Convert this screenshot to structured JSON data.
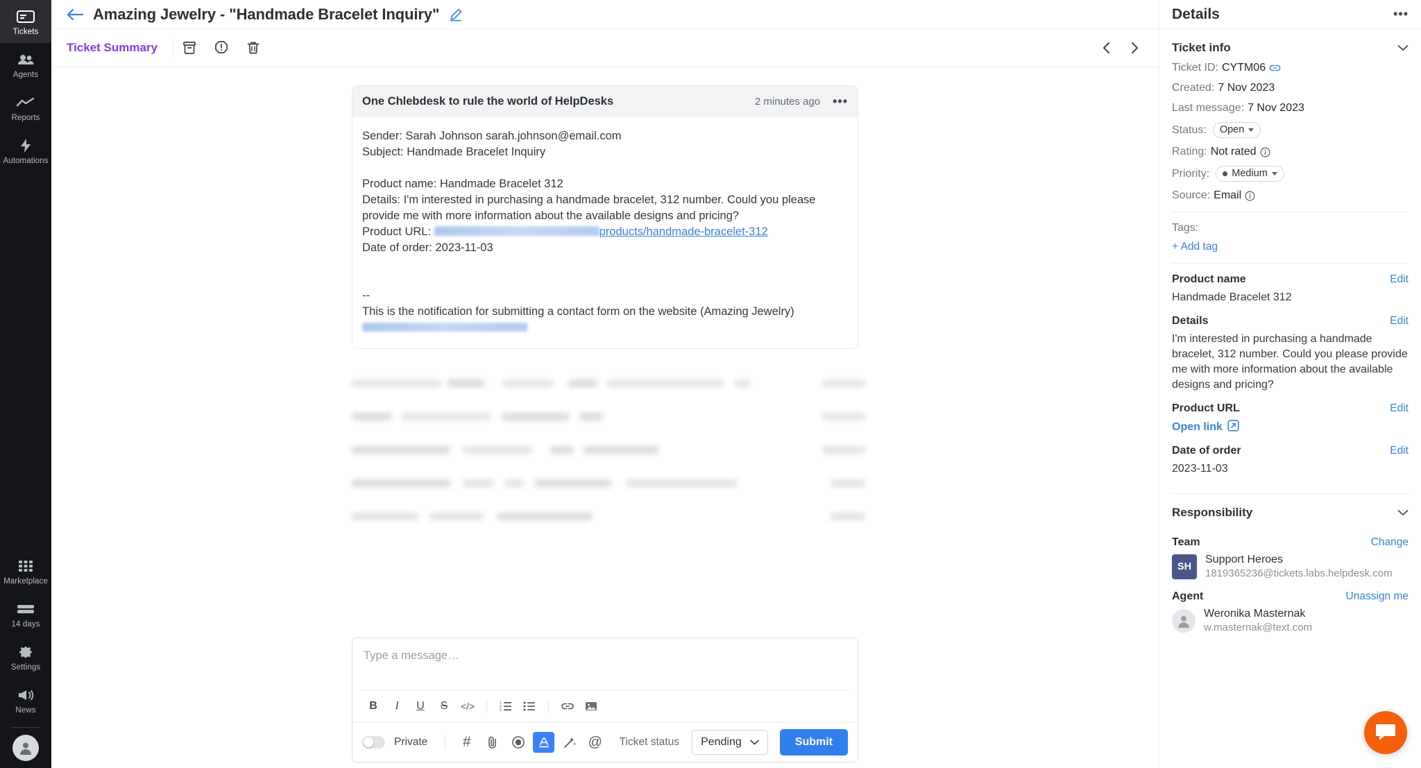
{
  "sidebar": {
    "items": [
      {
        "label": "Tickets",
        "icon": "ticket-icon",
        "active": true
      },
      {
        "label": "Agents",
        "icon": "agents-icon",
        "active": false
      },
      {
        "label": "Reports",
        "icon": "reports-icon",
        "active": false
      },
      {
        "label": "Automations",
        "icon": "automations-icon",
        "active": false
      }
    ],
    "bottom_items": [
      {
        "label": "Marketplace",
        "icon": "marketplace-icon"
      },
      {
        "label": "14 days",
        "icon": "trial-icon"
      },
      {
        "label": "Settings",
        "icon": "gear-icon"
      },
      {
        "label": "News",
        "icon": "megaphone-icon"
      }
    ]
  },
  "header": {
    "back_icon": "arrow-left-icon",
    "title": "Amazing Jewelry - \"Handmade Bracelet Inquiry\"",
    "edit_icon": "pencil-icon"
  },
  "toolbar": {
    "tab_label": "Ticket Summary",
    "archive_icon": "archive-icon",
    "spam_icon": "spam-icon",
    "delete_icon": "trash-icon",
    "prev_icon": "chevron-left-icon",
    "next_icon": "chevron-right-icon"
  },
  "message": {
    "header_title": "One Chlebdesk to rule the world of HelpDesks",
    "time": "2 minutes ago",
    "more_icon": "ellipsis-icon",
    "sender_line": "Sender: Sarah Johnson sarah.johnson@email.com",
    "subject_line": "Subject: Handmade Bracelet Inquiry",
    "product_name_line": "Product name: Handmade Bracelet 312",
    "details_line": "Details: I'm interested in purchasing a handmade bracelet, 312 number. Could you please provide me with more information about the available designs and pricing?",
    "product_url_label": "Product URL:",
    "product_url_visible": "products/handmade-bracelet-312",
    "date_line": "Date of order: 2023-11-03",
    "signature_dashes": "--",
    "signature_line": "This is the notification for submitting a contact form on the website (Amazing Jewelry)"
  },
  "composer": {
    "placeholder": "Type a message…",
    "value": "",
    "format_buttons": [
      {
        "name": "bold-button",
        "glyph": "B"
      },
      {
        "name": "italic-button",
        "glyph": "I"
      },
      {
        "name": "underline-button",
        "glyph": "U"
      },
      {
        "name": "strikethrough-button",
        "glyph": "S"
      },
      {
        "name": "code-button",
        "glyph": "</>"
      },
      {
        "name": "ordered-list-button",
        "glyph": ""
      },
      {
        "name": "bullet-list-button",
        "glyph": ""
      },
      {
        "name": "link-button",
        "glyph": ""
      },
      {
        "name": "image-button",
        "glyph": ""
      }
    ],
    "private_label": "Private",
    "private_on": false,
    "action_icons": [
      "hash-icon",
      "paperclip-icon",
      "record-icon",
      "text-format-icon",
      "ai-wand-icon",
      "mention-icon"
    ],
    "status_label": "Ticket status",
    "status_value": "Pending",
    "submit_label": "Submit"
  },
  "details": {
    "title": "Details",
    "more_icon": "ellipsis-icon",
    "ticket_info": {
      "section_title": "Ticket info",
      "ticket_id_label": "Ticket ID:",
      "ticket_id": "CYTM06",
      "copy_icon": "link-icon",
      "created_label": "Created:",
      "created": "7 Nov 2023",
      "last_message_label": "Last message:",
      "last_message": "7 Nov 2023",
      "status_label": "Status:",
      "status": "Open",
      "rating_label": "Rating:",
      "rating": "Not rated",
      "priority_label": "Priority:",
      "priority": "Medium",
      "source_label": "Source:",
      "source": "Email"
    },
    "tags": {
      "label": "Tags:",
      "add_label": "+ Add tag"
    },
    "fields": [
      {
        "label": "Product name",
        "edit": "Edit",
        "value": "Handmade Bracelet 312",
        "kind": "text"
      },
      {
        "label": "Details",
        "edit": "Edit",
        "value": "I'm interested in purchasing a handmade bracelet, 312 number. Could you please provide me with more information about the available designs and pricing?",
        "kind": "text"
      },
      {
        "label": "Product URL",
        "edit": "Edit",
        "value": "Open link",
        "kind": "link"
      },
      {
        "label": "Date of order",
        "edit": "Edit",
        "value": "2023-11-03",
        "kind": "text"
      }
    ],
    "responsibility": {
      "section_title": "Responsibility",
      "team_label": "Team",
      "team_change": "Change",
      "team_initials": "SH",
      "team_name": "Support Heroes",
      "team_email": "1819365236@tickets.labs.helpdesk.com",
      "agent_label": "Agent",
      "agent_unassign": "Unassign me",
      "agent_name": "Weronika Masternak",
      "agent_email": "w.masternak@text.com"
    }
  },
  "chat_widget": {
    "icon": "chat-bubble-icon",
    "color": "#f4600c"
  }
}
